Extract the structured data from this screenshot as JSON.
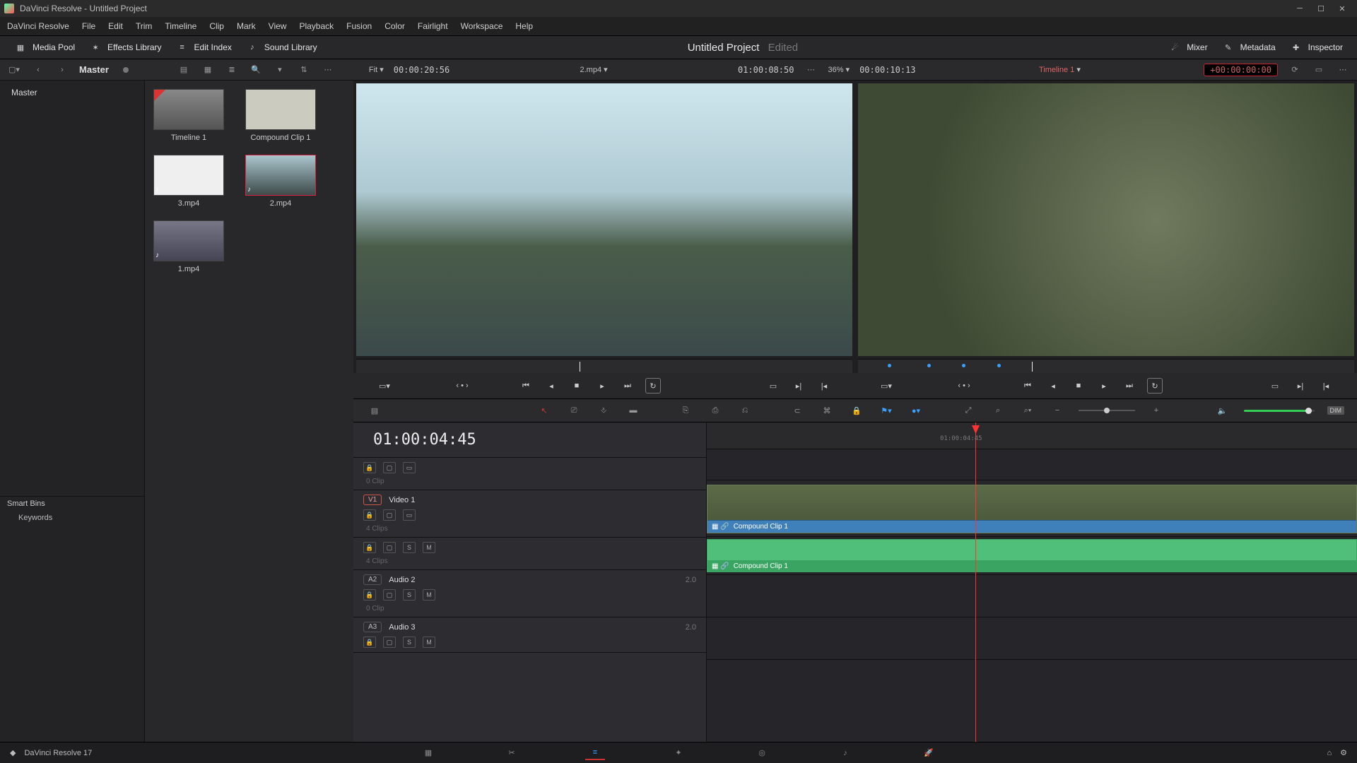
{
  "titlebar": {
    "text": "DaVinci Resolve - Untitled Project"
  },
  "menus": [
    "DaVinci Resolve",
    "File",
    "Edit",
    "Trim",
    "Timeline",
    "Clip",
    "Mark",
    "View",
    "Playback",
    "Fusion",
    "Color",
    "Fairlight",
    "Workspace",
    "Help"
  ],
  "toolbar_buttons": {
    "media_pool": "Media Pool",
    "effects_library": "Effects Library",
    "edit_index": "Edit Index",
    "sound_library": "Sound Library",
    "mixer": "Mixer",
    "metadata": "Metadata",
    "inspector": "Inspector"
  },
  "project": {
    "name": "Untitled Project",
    "status": "Edited"
  },
  "strip": {
    "bin": "Master",
    "fit_label": "Fit",
    "src_duration": "00:00:20:56",
    "clip_name": "2.mp4",
    "rec_tc": "01:00:08:50",
    "zoom_pct": "36%",
    "rec_duration": "00:00:10:13",
    "timeline_name": "Timeline 1",
    "tc_entry": "+00:00:00:00"
  },
  "sidebar": {
    "root": "Master",
    "smart_bins": "Smart Bins",
    "keywords": "Keywords"
  },
  "pool": {
    "items": [
      {
        "name": "Timeline 1",
        "flag": true
      },
      {
        "name": "Compound Clip 1"
      },
      {
        "name": "3.mp4",
        "audio": true
      },
      {
        "name": "2.mp4",
        "audio": true,
        "selected": true
      },
      {
        "name": "1.mp4",
        "audio": true
      }
    ]
  },
  "timeline": {
    "playhead_tc": "01:00:04:45",
    "ruler_label": "01:00:04:45",
    "tracks": {
      "v2": {
        "clips_meta": "0 Clip"
      },
      "v1": {
        "id": "V1",
        "name": "Video 1",
        "clips_meta": "4 Clips",
        "clip_label": "Compound Clip 1"
      },
      "a1": {
        "clips_meta": "4 Clips",
        "clip_label": "Compound Clip 1",
        "s": "S",
        "m": "M"
      },
      "a2": {
        "id": "A2",
        "name": "Audio 2",
        "ch": "2.0",
        "clips_meta": "0 Clip",
        "s": "S",
        "m": "M"
      },
      "a3": {
        "id": "A3",
        "name": "Audio 3",
        "ch": "2.0",
        "s": "S",
        "m": "M"
      }
    }
  },
  "footer": {
    "app": "DaVinci Resolve 17"
  },
  "vol": {
    "dim": "DIM"
  }
}
